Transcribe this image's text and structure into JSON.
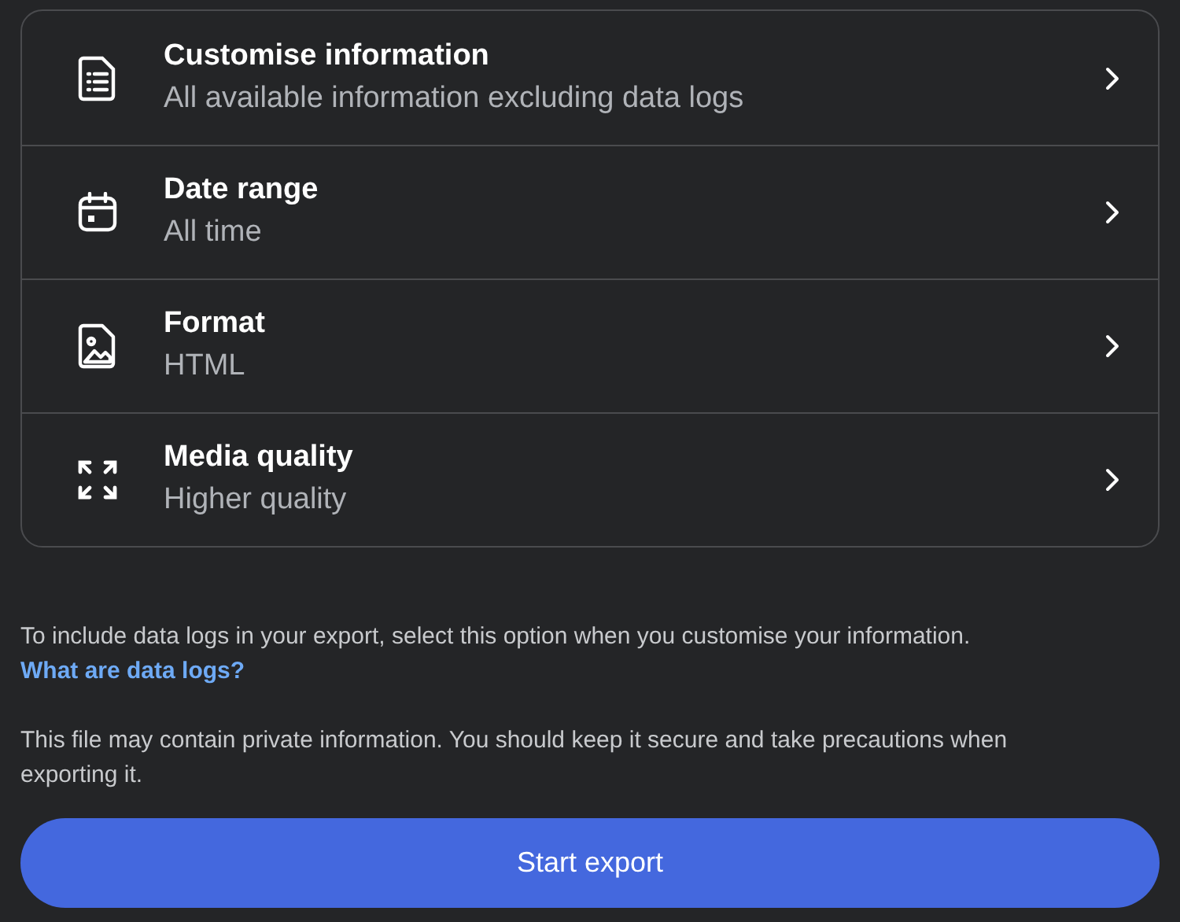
{
  "options": [
    {
      "kind": "list",
      "title": "Customise information",
      "subtitle": "All available information excluding data logs"
    },
    {
      "kind": "calendar",
      "title": "Date range",
      "subtitle": "All time"
    },
    {
      "kind": "image",
      "title": "Format",
      "subtitle": "HTML"
    },
    {
      "kind": "expand",
      "title": "Media quality",
      "subtitle": "Higher quality"
    }
  ],
  "note": {
    "text": "To include data logs in your export, select this option when you customise your information.",
    "link": "What are data logs?"
  },
  "warning": "This file may contain private information. You should keep it secure and take precautions when exporting it.",
  "button": "Start export"
}
